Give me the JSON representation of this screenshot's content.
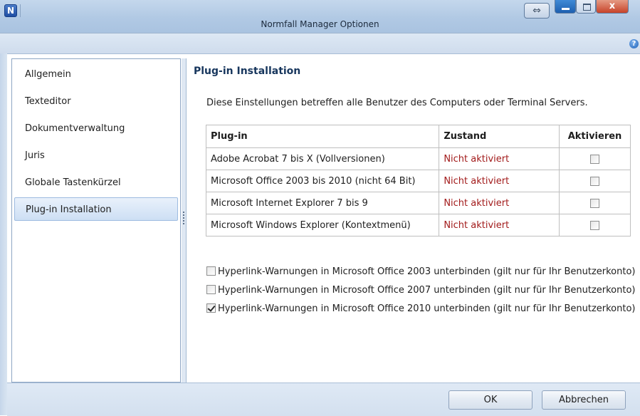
{
  "window": {
    "title": "Normfall Manager Optionen",
    "app_icon_letter": "N",
    "back_glyph": "⇔",
    "close_glyph": "x",
    "help_glyph": "?"
  },
  "nav": {
    "items": [
      {
        "label": "Allgemein",
        "active": false
      },
      {
        "label": "Texteditor",
        "active": false
      },
      {
        "label": "Dokumentverwaltung",
        "active": false
      },
      {
        "label": "Juris",
        "active": false
      },
      {
        "label": "Globale Tastenkürzel",
        "active": false
      },
      {
        "label": "Plug-in Installation",
        "active": true
      }
    ]
  },
  "main": {
    "title": "Plug-in Installation",
    "description": "Diese Einstellungen betreffen alle Benutzer des Computers oder Terminal Servers.",
    "table": {
      "headers": {
        "plugin": "Plug-in",
        "state": "Zustand",
        "activate": "Aktivieren"
      },
      "rows": [
        {
          "plugin": "Adobe Acrobat 7 bis X (Vollversionen)",
          "state": "Nicht aktiviert",
          "checked": false
        },
        {
          "plugin": "Microsoft Office 2003 bis 2010 (nicht 64 Bit)",
          "state": "Nicht aktiviert",
          "checked": false
        },
        {
          "plugin": "Microsoft Internet Explorer 7 bis 9",
          "state": "Nicht aktiviert",
          "checked": false
        },
        {
          "plugin": "Microsoft Windows Explorer (Kontextmenü)",
          "state": "Nicht aktiviert",
          "checked": false
        }
      ]
    },
    "options": [
      {
        "label": "Hyperlink-Warnungen in Microsoft Office 2003 unterbinden (gilt nur für Ihr Benutzerkonto)",
        "checked": false
      },
      {
        "label": "Hyperlink-Warnungen in Microsoft Office 2007 unterbinden (gilt nur für Ihr Benutzerkonto)",
        "checked": false
      },
      {
        "label": "Hyperlink-Warnungen in Microsoft Office 2010 unterbinden (gilt nur für Ihr Benutzerkonto)",
        "checked": true
      }
    ]
  },
  "buttons": {
    "ok": "OK",
    "cancel": "Abbrechen"
  },
  "colors": {
    "state_text": "#a21b1b",
    "heading": "#17365d",
    "accent": "#1d5fb0"
  }
}
